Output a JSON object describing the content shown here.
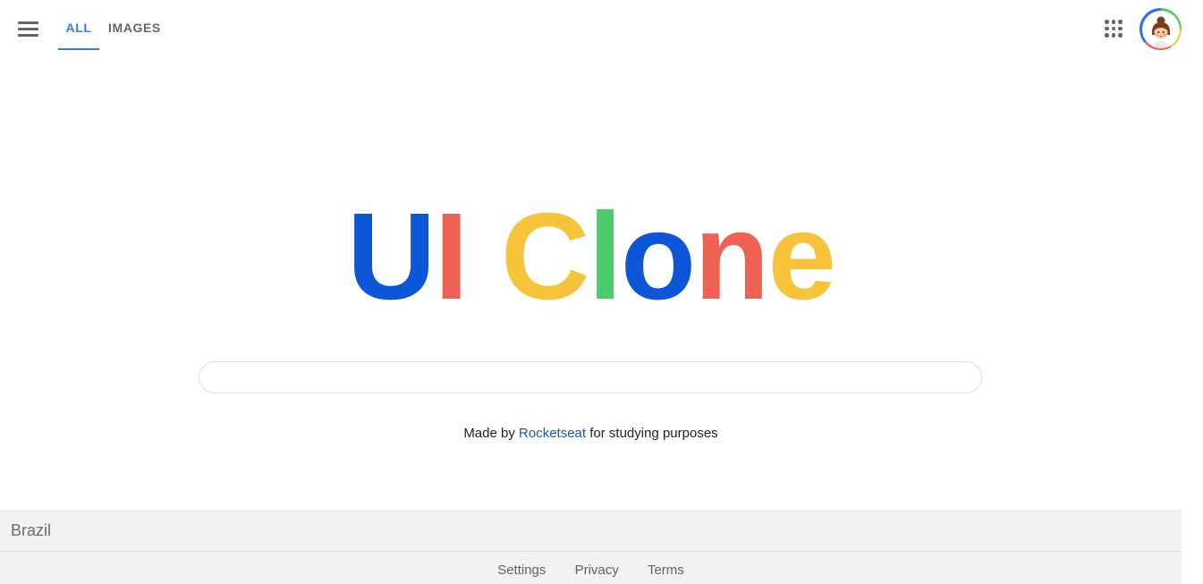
{
  "header": {
    "tabs": [
      {
        "label": "ALL",
        "active": true
      },
      {
        "label": "IMAGES",
        "active": false
      }
    ],
    "menu_icon": "hamburger-menu-icon",
    "apps_icon": "apps-grid-icon",
    "avatar_icon": "user-avatar-icon"
  },
  "logo": {
    "letters": [
      {
        "char": "U",
        "color": "#0d56d8"
      },
      {
        "char": "I",
        "color": "#ef6152"
      },
      {
        "char": "C",
        "color": "#f6c33b"
      },
      {
        "char": "l",
        "color": "#4ecb6b"
      },
      {
        "char": "o",
        "color": "#0d56d8"
      },
      {
        "char": "n",
        "color": "#ef6152"
      },
      {
        "char": "e",
        "color": "#f6c33b"
      }
    ]
  },
  "search": {
    "value": "",
    "placeholder": ""
  },
  "credit": {
    "prefix": "Made by",
    "link_text": "Rocketseat",
    "suffix": "for studying purposes"
  },
  "footer": {
    "country": "Brazil",
    "links": [
      "Settings",
      "Privacy",
      "Terms"
    ]
  },
  "colors": {
    "accent": "#3b78e7",
    "link": "#1a56c4",
    "footer_bg": "#f2f2f2"
  }
}
